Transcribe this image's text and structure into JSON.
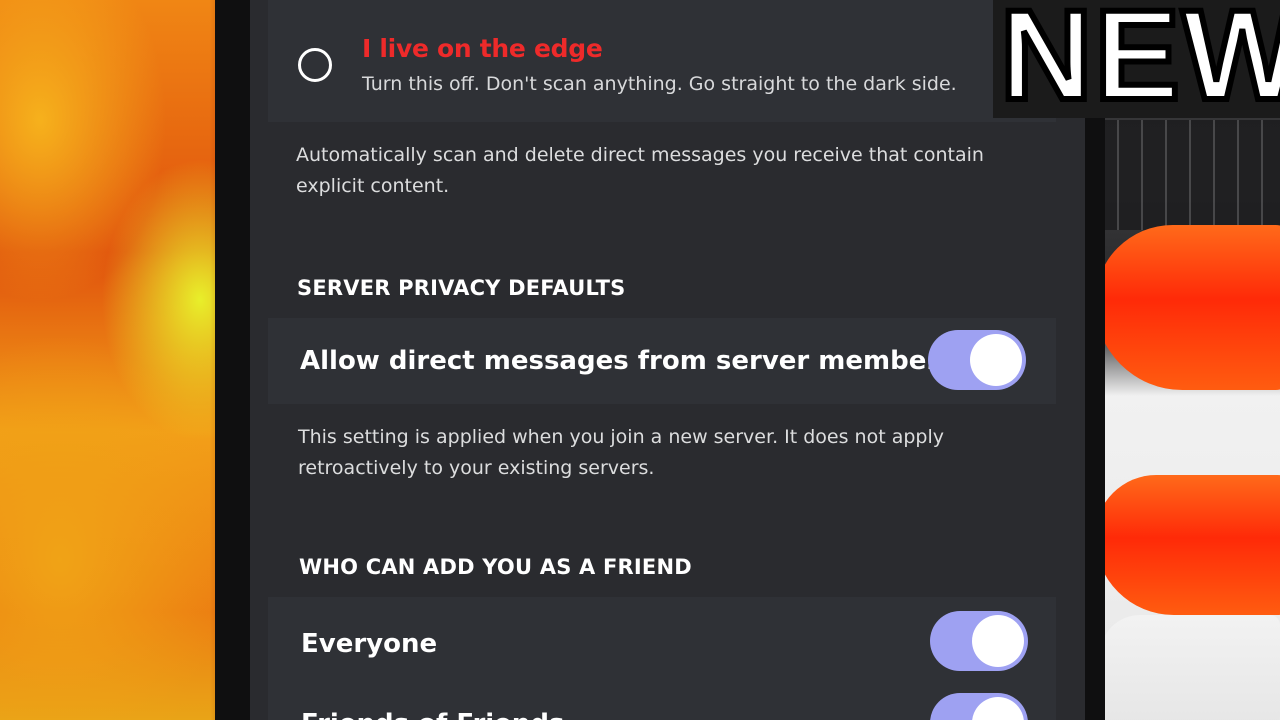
{
  "overlay": {
    "badge_text": "NEW"
  },
  "explicit_filter": {
    "option_title": "I live on the edge",
    "option_subtitle": "Turn this off. Don't scan anything. Go straight to the dark side.",
    "option_selected": false,
    "description": "Automatically scan and delete direct messages you receive that contain explicit content."
  },
  "server_privacy": {
    "header": "SERVER PRIVACY DEFAULTS",
    "toggle_label": "Allow direct messages from server members.",
    "toggle_on": true,
    "description": "This setting is applied when you join a new server. It does not apply retroactively to your existing servers."
  },
  "friend_requests": {
    "header": "WHO CAN ADD YOU AS A FRIEND",
    "items": [
      {
        "label": "Everyone",
        "toggle_on": true
      },
      {
        "label": "Friends of Friends",
        "toggle_on": true
      }
    ]
  },
  "colors": {
    "accent_red": "#ee2a2a",
    "toggle_on": "#9ea1f2",
    "screen_bg": "#2a2b2f",
    "row_bg": "#2f3136"
  }
}
